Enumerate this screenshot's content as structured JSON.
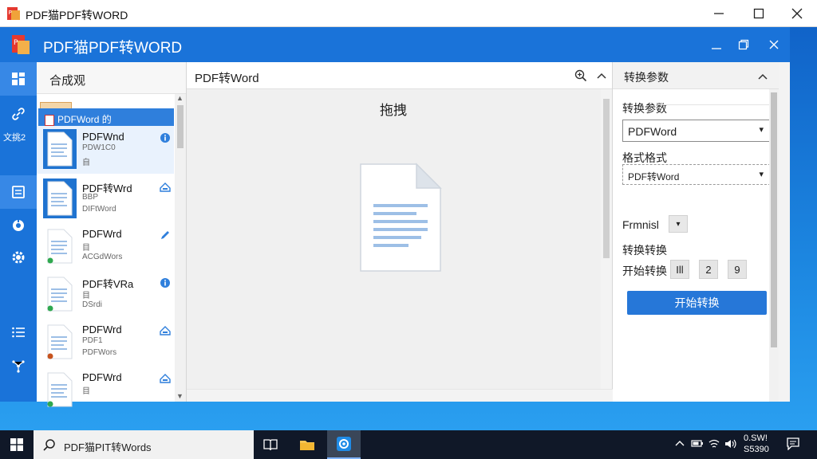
{
  "outer_window": {
    "title": "PDF猫PDF转WORD"
  },
  "app": {
    "title": "PDF猫PDF转WORD"
  },
  "rail": {
    "label": "文挑2"
  },
  "file_list": {
    "header": "合成观",
    "tooltip": "PDFWord 的",
    "items": [
      {
        "name": "PDFWnd",
        "sub1": "PDW1C0",
        "sub2": "自",
        "status": "info",
        "status_color": "#2f7fdc"
      },
      {
        "name": "PDF转Wrd",
        "sub1": "BBP",
        "sub2": "DIFtWord",
        "status": "warn",
        "status_color": "#2f7fdc"
      },
      {
        "name": "PDFWrd",
        "sub1": "目",
        "sub2": "ACGdWors",
        "status": "edit",
        "status_color": "#2f7fdc"
      },
      {
        "name": "PDF转VRa",
        "sub1": "目",
        "sub2": "DSrdi",
        "status": "info",
        "status_color": "#2f7fdc"
      },
      {
        "name": "PDFWrd",
        "sub1": "PDF1",
        "sub2": "PDFWors",
        "status": "warn",
        "status_color": "#2f7fdc"
      },
      {
        "name": "PDFWrd",
        "sub1": "目",
        "sub2": "",
        "status": "warn",
        "status_color": "#2f7fdc"
      }
    ]
  },
  "main": {
    "title": "PDF转Word",
    "drop_label": "拖拽"
  },
  "settings": {
    "header": "转换参数",
    "section_label": "转换参数",
    "format_select": "PDFWord",
    "format_label": "格式格式",
    "format_select2": "PDF转Word",
    "font_label": "Frmnisl",
    "convert_label": "转换转换",
    "start_label": "开始转换",
    "num_buttons": [
      "Ill",
      "2",
      "9"
    ],
    "start_button": "开始转换"
  },
  "taskbar": {
    "search_text": "PDF猫PIT转Words",
    "clock_time": "0.SW!",
    "clock_date": "S5390"
  },
  "colors": {
    "brand_blue": "#1a73d9",
    "accent": "#2677d8",
    "taskbar": "#101828"
  }
}
